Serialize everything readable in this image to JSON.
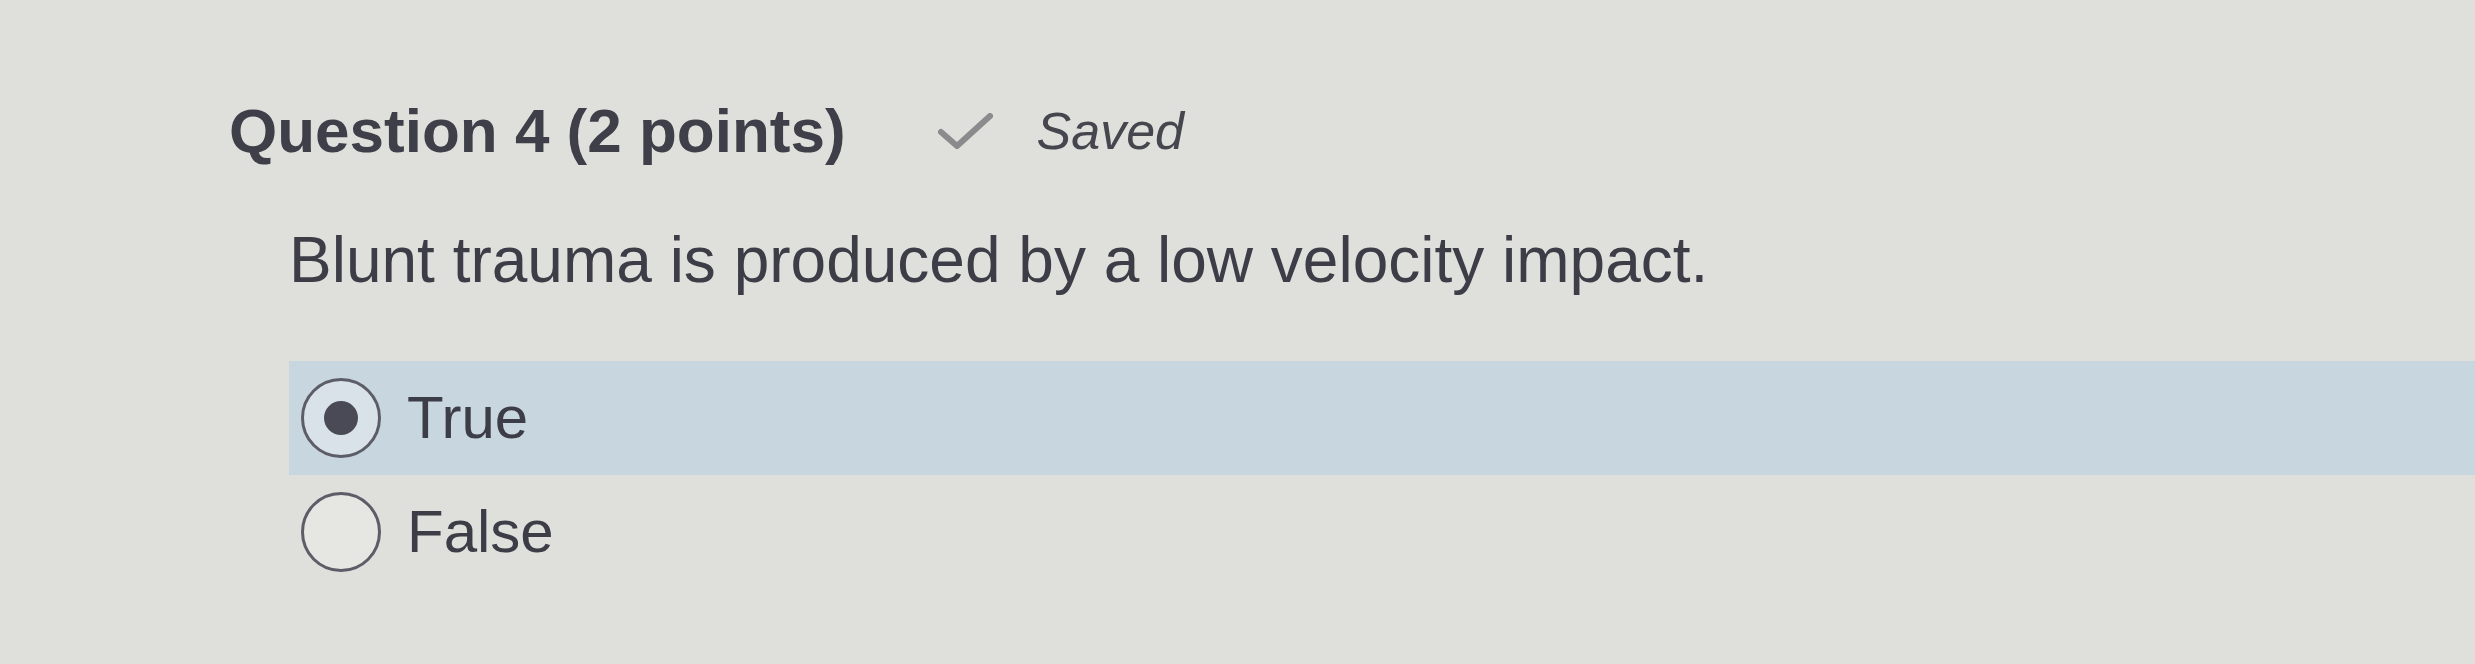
{
  "question": {
    "title": "Question 4 (2 points)",
    "status": "Saved",
    "prompt": "Blunt trauma is produced by a low velocity impact.",
    "options": [
      {
        "label": "True",
        "selected": true
      },
      {
        "label": "False",
        "selected": false
      }
    ]
  }
}
